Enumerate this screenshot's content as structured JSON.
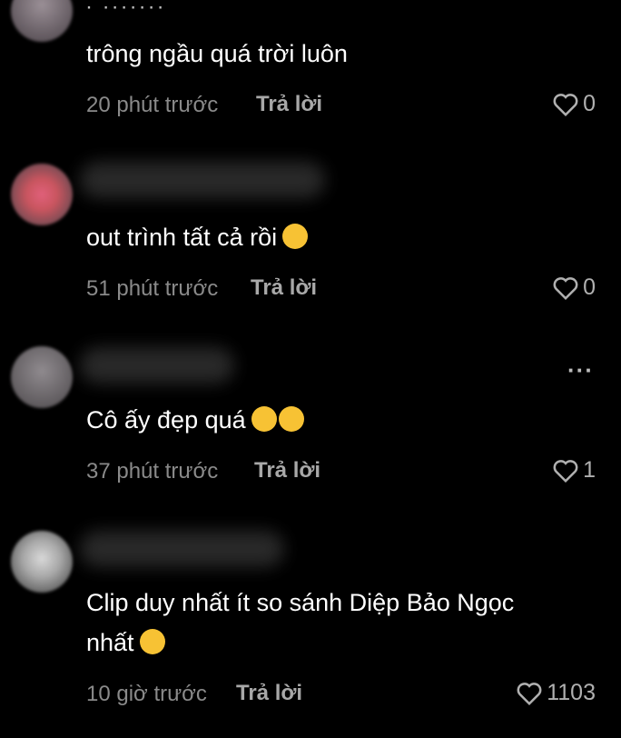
{
  "comments": [
    {
      "username": "· ·······",
      "text": "trông ngầu quá trời luôn",
      "time": "20 phút trước",
      "reply": "Trả lời",
      "likes": "0"
    },
    {
      "username": "",
      "text": "out trình tất cả rồi",
      "emoji": "grinning-sweat-emoji",
      "time": "51 phút trước",
      "reply": "Trả lời",
      "likes": "0"
    },
    {
      "username": "",
      "text": "Cô ấy đẹp quá",
      "emoji": "heart-eyes-emoji",
      "time": "37 phút trước",
      "reply": "Trả lời",
      "likes": "1",
      "more": "···"
    },
    {
      "username": "",
      "text_line1": "Clip duy nhất ít so sánh Diệp Bảo Ngọc",
      "text_line2": "nhất",
      "emoji": "tears-of-joy-emoji",
      "time": "10 giờ trước",
      "reply": "Trả lời",
      "likes": "1103"
    }
  ],
  "colors": {
    "background": "#000000",
    "text": "#ffffff",
    "meta": "#8a8a8a"
  }
}
